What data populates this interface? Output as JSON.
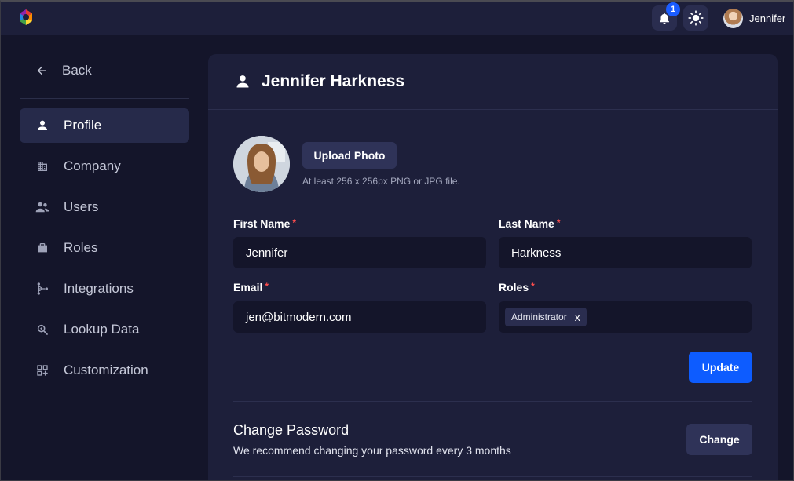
{
  "topbar": {
    "notification_count": "1",
    "user_name": "Jennifer"
  },
  "sidebar": {
    "back_label": "Back",
    "items": [
      {
        "label": "Profile",
        "icon": "person-icon",
        "active": true
      },
      {
        "label": "Company",
        "icon": "building-icon",
        "active": false
      },
      {
        "label": "Users",
        "icon": "users-icon",
        "active": false
      },
      {
        "label": "Roles",
        "icon": "briefcase-icon",
        "active": false
      },
      {
        "label": "Integrations",
        "icon": "integrations-icon",
        "active": false
      },
      {
        "label": "Lookup Data",
        "icon": "search-zoom-icon",
        "active": false
      },
      {
        "label": "Customization",
        "icon": "grid-plus-icon",
        "active": false
      }
    ]
  },
  "profile": {
    "title": "Jennifer Harkness",
    "upload_label": "Upload Photo",
    "upload_hint": "At least 256 x 256px PNG or JPG file.",
    "first_name": {
      "label": "First Name",
      "value": "Jennifer"
    },
    "last_name": {
      "label": "Last Name",
      "value": "Harkness"
    },
    "email": {
      "label": "Email",
      "value": "jen@bitmodern.com"
    },
    "roles": {
      "label": "Roles",
      "chips": [
        "Administrator"
      ],
      "remove_glyph": "x"
    },
    "required_marker": "*",
    "update_label": "Update"
  },
  "password": {
    "title": "Change Password",
    "description": "We recommend changing your password every 3 months",
    "change_label": "Change"
  },
  "colors": {
    "background": "#14152a",
    "surface": "#1d1f3a",
    "accent": "#0d5cff",
    "required": "#ff4d4d"
  }
}
